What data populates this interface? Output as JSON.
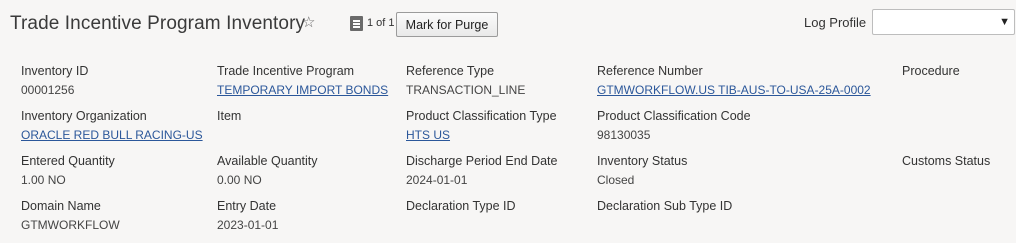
{
  "header": {
    "title": "Trade Incentive Program Inventory",
    "record_count": "1 of 1",
    "mark_for_purge_label": "Mark for Purge",
    "log_profile_label": "Log Profile",
    "log_profile_value": ""
  },
  "fields": {
    "inventory_id": {
      "label": "Inventory ID",
      "value": "00001256"
    },
    "trade_incentive_program": {
      "label": "Trade Incentive Program",
      "value": "TEMPORARY IMPORT BONDS"
    },
    "reference_type": {
      "label": "Reference Type",
      "value": "TRANSACTION_LINE"
    },
    "reference_number": {
      "label": "Reference Number",
      "value": "GTMWORKFLOW.US TIB-AUS-TO-USA-25A-0002"
    },
    "procedure": {
      "label": "Procedure",
      "value": ""
    },
    "inventory_organization": {
      "label": "Inventory Organization",
      "value": "ORACLE RED BULL RACING-US"
    },
    "item": {
      "label": "Item",
      "value": ""
    },
    "product_classification_type": {
      "label": "Product Classification Type",
      "value": "HTS US"
    },
    "product_classification_code": {
      "label": "Product Classification Code",
      "value": "98130035"
    },
    "entered_quantity": {
      "label": "Entered Quantity",
      "value": "1.00 NO"
    },
    "available_quantity": {
      "label": "Available Quantity",
      "value": "0.00 NO"
    },
    "discharge_period_end_date": {
      "label": "Discharge Period End Date",
      "value": "2024-01-01"
    },
    "inventory_status": {
      "label": "Inventory Status",
      "value": "Closed"
    },
    "customs_status": {
      "label": "Customs Status",
      "value": ""
    },
    "domain_name": {
      "label": "Domain Name",
      "value": "GTMWORKFLOW"
    },
    "entry_date": {
      "label": "Entry Date",
      "value": "2023-01-01"
    },
    "declaration_type_id": {
      "label": "Declaration Type ID",
      "value": ""
    },
    "declaration_sub_type_id": {
      "label": "Declaration Sub Type ID",
      "value": ""
    }
  }
}
